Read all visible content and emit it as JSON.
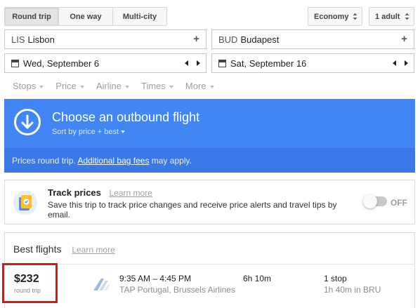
{
  "trip_type": {
    "options": [
      "Round trip",
      "One way",
      "Multi-city"
    ],
    "selected": "Round trip"
  },
  "cabin_class": "Economy",
  "passengers": "1 adult",
  "origin": {
    "code": "LIS",
    "city": "Lisbon"
  },
  "destination": {
    "code": "BUD",
    "city": "Budapest"
  },
  "depart_date": "Wed, September 6",
  "return_date": "Sat, September 16",
  "filters": [
    "Stops",
    "Price",
    "Airline",
    "Times",
    "More"
  ],
  "banner": {
    "title": "Choose an outbound flight",
    "sort": "Sort by price + best",
    "note_prefix": "Prices round trip.",
    "note_link": "Additional bag fees",
    "note_suffix": "may apply."
  },
  "track": {
    "title": "Track prices",
    "learn_more": "Learn more",
    "description": "Save this trip to track price changes and receive price alerts and travel tips by email.",
    "toggle_label": "OFF"
  },
  "best_flights": {
    "heading": "Best flights",
    "learn_more": "Learn more",
    "flights": [
      {
        "price": "$232",
        "price_note": "round trip",
        "times": "9:35 AM – 4:45 PM",
        "carrier": "TAP Portugal, Brussels Airlines",
        "duration": "6h 10m",
        "stops": "1 stop",
        "layover": "1h 40m in BRU"
      }
    ]
  },
  "colors": {
    "banner": "#4285f4",
    "banner_bottom": "#3b78e7",
    "highlight_box": "#e0131b"
  },
  "icons": [
    "plus-icon",
    "calendar-icon",
    "arrow-left-icon",
    "arrow-right-icon",
    "down-arrow-circle-icon",
    "track-prices-icon",
    "airline-logo-icon"
  ]
}
